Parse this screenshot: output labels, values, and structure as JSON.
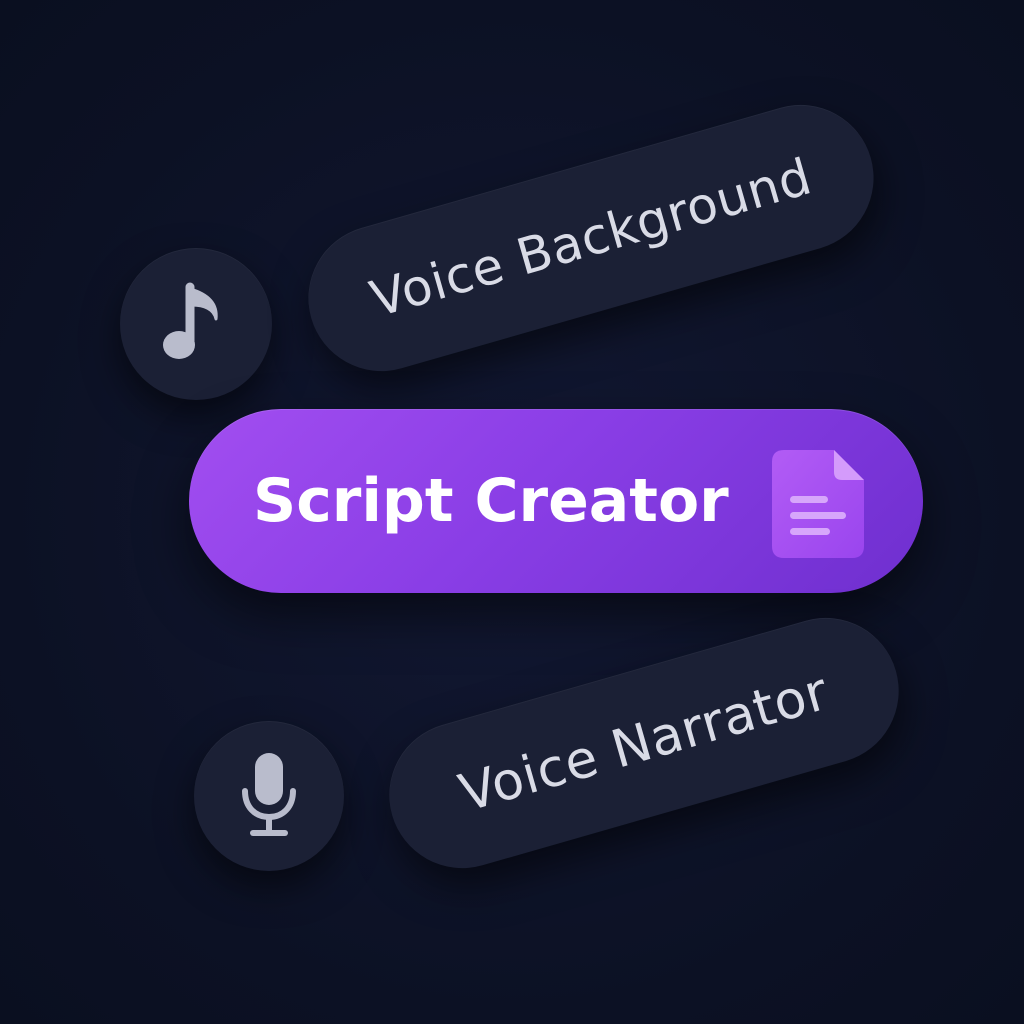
{
  "items": {
    "voice_background": {
      "label": "Voice Background",
      "icon": "music-note-icon"
    },
    "script_creator": {
      "label": "Script Creator",
      "icon": "document-icon",
      "accent": "#8a3ee6"
    },
    "voice_narrator": {
      "label": "Voice Narrator",
      "icon": "microphone-icon"
    }
  },
  "colors": {
    "background": "#0d1226",
    "card": "#1b2035",
    "text": "#d9dbe6",
    "icon": "#b9bccc",
    "accent_start": "#a24ef0",
    "accent_end": "#6f2fcf"
  }
}
